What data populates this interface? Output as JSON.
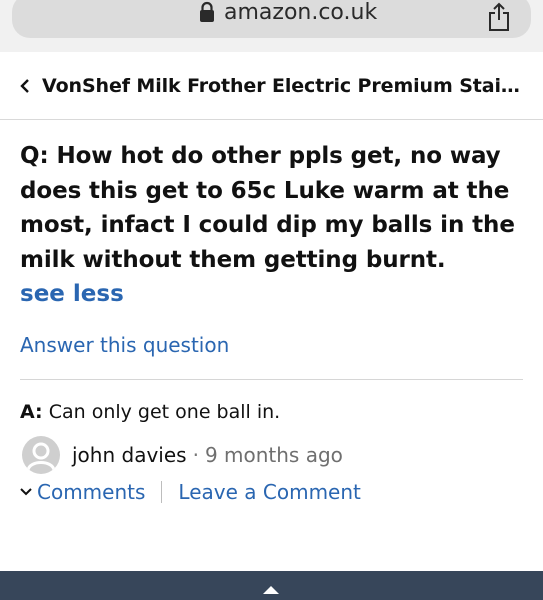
{
  "browser": {
    "url": "amazon.co.uk",
    "lock_icon": "lock-icon",
    "share_icon": "share-icon"
  },
  "header": {
    "back_icon": "chevron-left-icon",
    "product_title": "VonShef Milk Frother Electric Premium Stain..."
  },
  "question": {
    "text": "Q: How hot do other ppls get, no way does this get to 65c Luke warm at the most, infact I could dip my balls in the milk without them getting burnt.",
    "see_less": "see less",
    "answer_link": "Answer this question"
  },
  "answer": {
    "label": "A:",
    "text": "Can only get one ball in.",
    "author": "john davies",
    "separator": "·",
    "time": "9 months ago",
    "comments_label": "Comments",
    "leave_comment_label": "Leave a Comment"
  },
  "colors": {
    "link": "#2a66b1",
    "bottom_bar": "#37465a",
    "url_pill": "#dcdcdc"
  }
}
